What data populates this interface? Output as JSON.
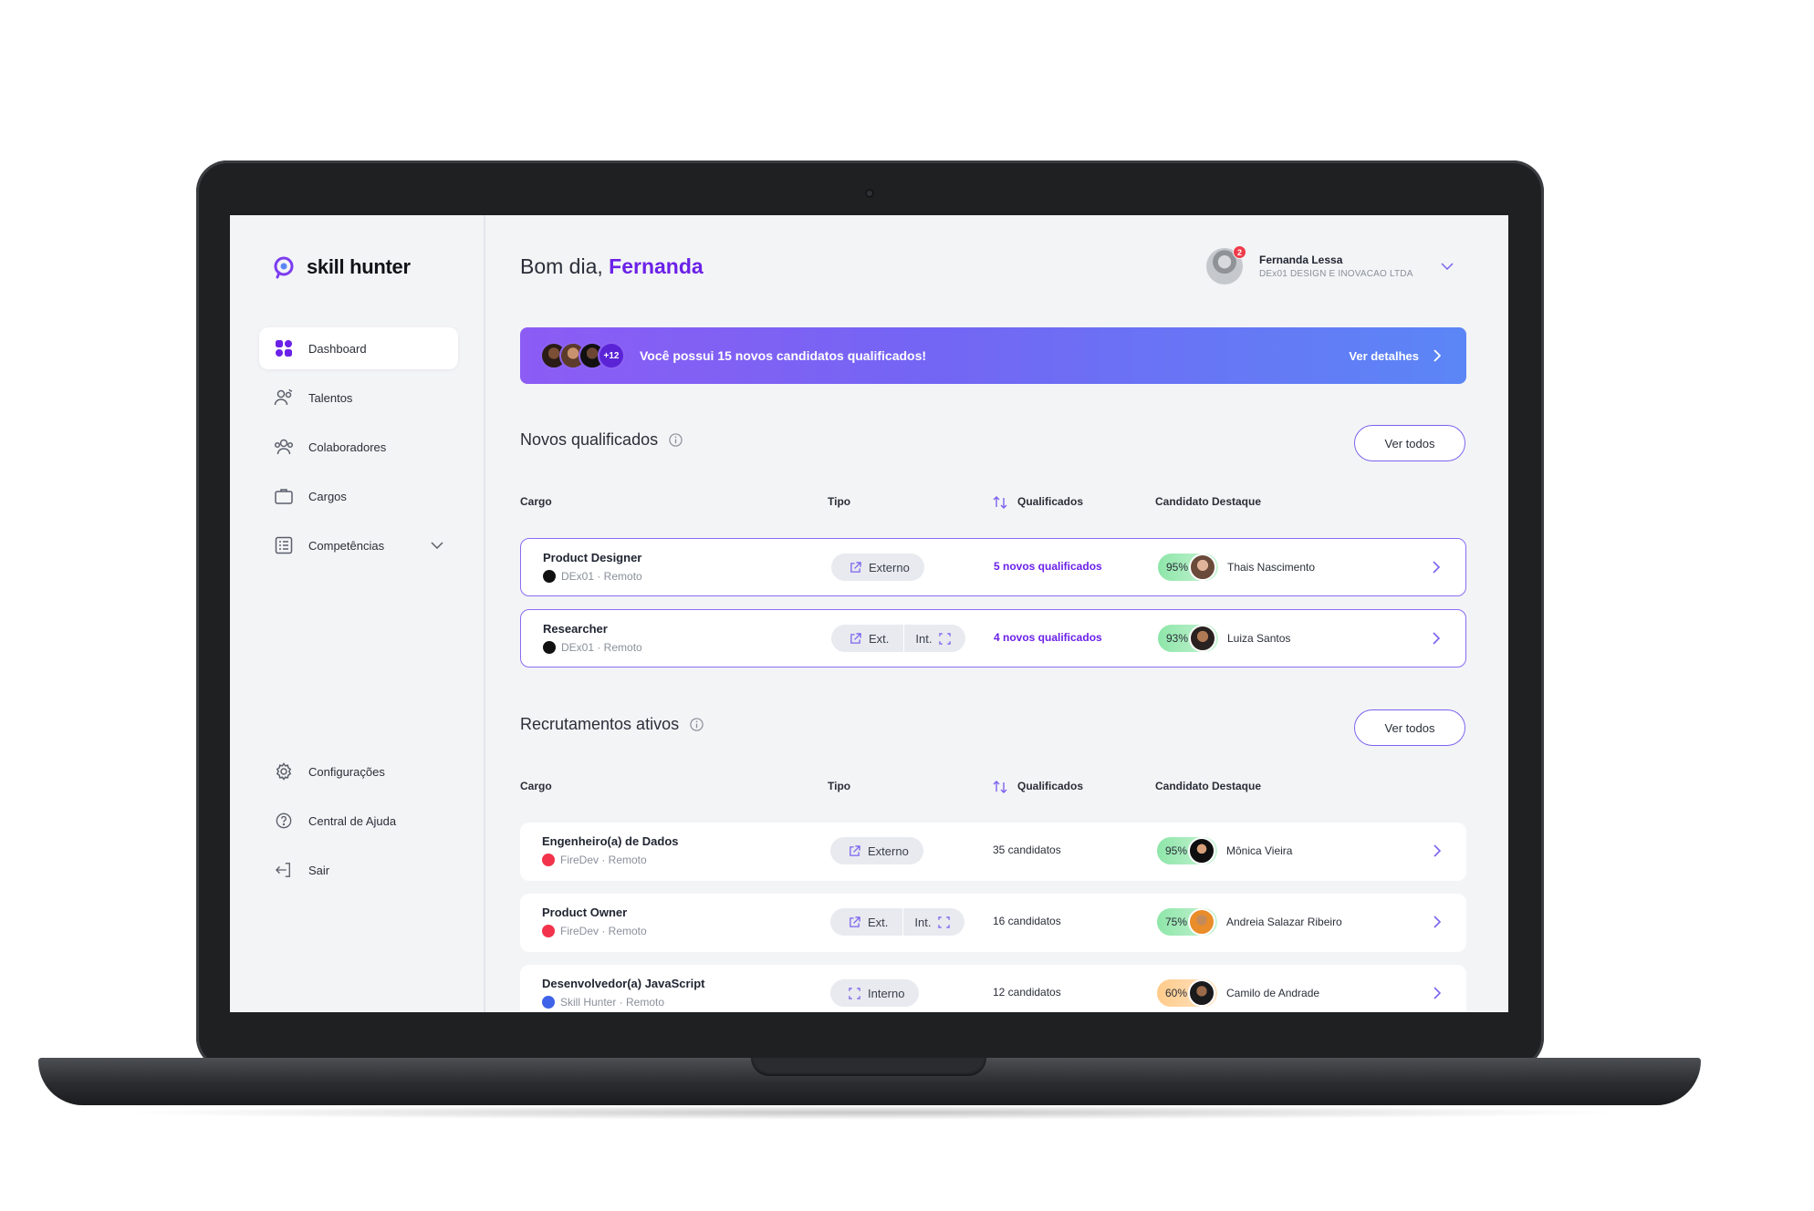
{
  "app": {
    "brand": "skill hunter"
  },
  "sidebar": {
    "items": [
      {
        "label": "Dashboard",
        "icon": "dashboard-icon",
        "active": true
      },
      {
        "label": "Talentos",
        "icon": "talents-icon"
      },
      {
        "label": "Colaboradores",
        "icon": "collaborators-icon"
      },
      {
        "label": "Cargos",
        "icon": "briefcase-icon"
      },
      {
        "label": "Competências",
        "icon": "list-icon"
      }
    ],
    "bottom_items": [
      {
        "label": "Configurações",
        "icon": "gear-icon"
      },
      {
        "label": "Central de Ajuda",
        "icon": "help-icon"
      },
      {
        "label": "Sair",
        "icon": "logout-icon"
      }
    ]
  },
  "header": {
    "greeting": "Bom dia,",
    "greeting_name": "Fernanda",
    "user_name": "Fernanda Lessa",
    "user_company": "DEx01 DESIGN E INOVACAO LTDA",
    "notification_count": "2"
  },
  "banner": {
    "more_count": "+12",
    "message": "Você possui 15 novos candidatos qualificados!",
    "link": "Ver detalhes"
  },
  "colors": {
    "accent": "#6b21e8",
    "banner_start": "#8c5cf5",
    "banner_end": "#5b86f6",
    "score_green": "#8ee6a9",
    "score_orange": "#ffcb8a"
  },
  "novos": {
    "title": "Novos qualificados",
    "view_all": "Ver todos",
    "columns": {
      "cargo": "Cargo",
      "tipo": "Tipo",
      "qualificados": "Qualificados",
      "destaque": "Candidato Destaque"
    },
    "rows": [
      {
        "title": "Product Designer",
        "sub": "DEx01 · Remoto",
        "tipo": [
          "Externo"
        ],
        "qualificados": "5 novos qualificados",
        "score": "95%",
        "candidate": "Thais Nascimento"
      },
      {
        "title": "Researcher",
        "sub": "DEx01 · Remoto",
        "tipo": [
          "Ext.",
          "Int."
        ],
        "qualificados": "4 novos qualificados",
        "score": "93%",
        "candidate": "Luiza Santos"
      }
    ]
  },
  "ativos": {
    "title": "Recrutamentos ativos",
    "view_all": "Ver todos",
    "columns": {
      "cargo": "Cargo",
      "tipo": "Tipo",
      "qualificados": "Qualificados",
      "destaque": "Candidato Destaque"
    },
    "rows": [
      {
        "title": "Engenheiro(a) de Dados",
        "sub": "FireDev · Remoto",
        "tipo": [
          "Externo"
        ],
        "qualificados": "35 candidatos",
        "score": "95%",
        "candidate": "Mônica Vieira"
      },
      {
        "title": "Product Owner",
        "sub": "FireDev · Remoto",
        "tipo": [
          "Ext.",
          "Int."
        ],
        "qualificados": "16 candidatos",
        "score": "75%",
        "candidate": "Andreia Salazar Ribeiro"
      },
      {
        "title": "Desenvolvedor(a) JavaScript",
        "sub": "Skill Hunter · Remoto",
        "tipo": [
          "Interno"
        ],
        "qualificados": "12 candidatos",
        "score": "60%",
        "candidate": "Camilo de Andrade"
      }
    ]
  }
}
